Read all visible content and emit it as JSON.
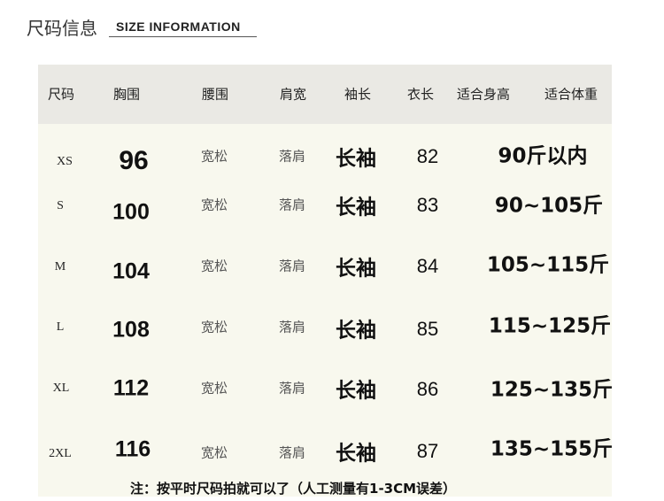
{
  "title": {
    "cn": "尺码信息",
    "en": "SIZE INFORMATION"
  },
  "headers": [
    "尺码",
    "胸围",
    "腰围",
    "肩宽",
    "袖长",
    "衣长",
    "适合身高",
    "适合体重"
  ],
  "rows": [
    {
      "size": "XS",
      "chest": "96",
      "waist": "宽松",
      "shoulder": "落肩",
      "sleeve": "长袖",
      "length": "82",
      "weight": "90斤以内"
    },
    {
      "size": "S",
      "chest": "100",
      "waist": "宽松",
      "shoulder": "落肩",
      "sleeve": "长袖",
      "length": "83",
      "weight": "90~105斤"
    },
    {
      "size": "M",
      "chest": "104",
      "waist": "宽松",
      "shoulder": "落肩",
      "sleeve": "长袖",
      "length": "84",
      "weight": "105~115斤"
    },
    {
      "size": "L",
      "chest": "108",
      "waist": "宽松",
      "shoulder": "落肩",
      "sleeve": "长袖",
      "length": "85",
      "weight": "115~125斤"
    },
    {
      "size": "XL",
      "chest": "112",
      "waist": "宽松",
      "shoulder": "落肩",
      "sleeve": "长袖",
      "length": "86",
      "weight": "125~135斤"
    },
    {
      "size": "2XL",
      "chest": "116",
      "waist": "宽松",
      "shoulder": "落肩",
      "sleeve": "长袖",
      "length": "87",
      "weight": "135~155斤"
    }
  ],
  "note": "注：按平时尺码拍就可以了（人工测量有1-3CM误差）"
}
